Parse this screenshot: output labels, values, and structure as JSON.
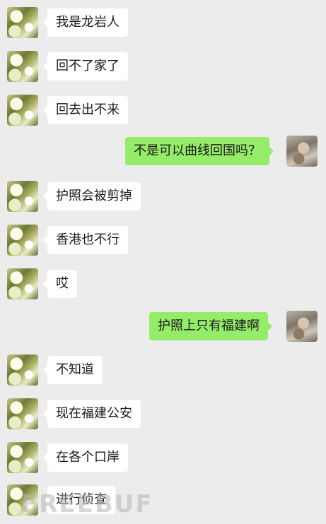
{
  "messages": [
    {
      "side": "left",
      "text": "我是龙岩人"
    },
    {
      "side": "left",
      "text": "回不了家了"
    },
    {
      "side": "left",
      "text": "回去出不来"
    },
    {
      "side": "right",
      "text": "不是可以曲线回国吗？"
    },
    {
      "side": "left",
      "text": "护照会被剪掉"
    },
    {
      "side": "left",
      "text": "香港也不行"
    },
    {
      "side": "left",
      "text": "哎"
    },
    {
      "side": "right",
      "text": "护照上只有福建啊"
    },
    {
      "side": "left",
      "text": "不知道"
    },
    {
      "side": "left",
      "text": "现在福建公安"
    },
    {
      "side": "left",
      "text": "在各个口岸"
    },
    {
      "side": "left",
      "text": "进行侦查"
    }
  ],
  "watermark": "FREEBUF",
  "colors": {
    "background": "#ececec",
    "incoming_bubble": "#ffffff",
    "outgoing_bubble": "#95ec69"
  }
}
